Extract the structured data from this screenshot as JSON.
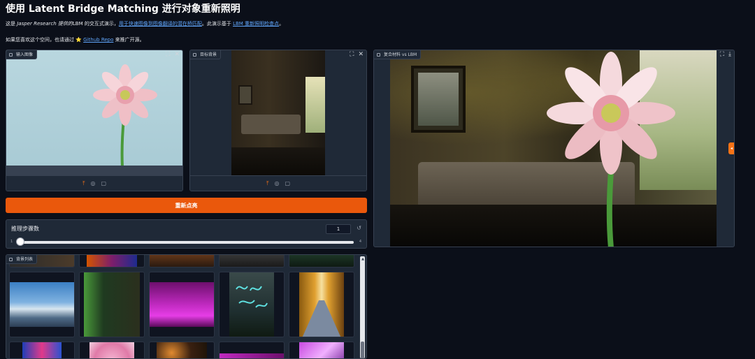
{
  "title": "使用 Latent Bridge Matching 进行对象重新照明",
  "intro": {
    "line1_prefix": "这是 ",
    "line1_org": "Jasper Research 提供的",
    "line1_mid": "LBM 的交互式演示，",
    "line1_link1": "用于快速图像到图像翻译的潜在桥匹配",
    "line1_mid2": "。此演示基于 ",
    "line1_link2": "LBM 重新照明检查点",
    "line1_suffix": "。",
    "line2_prefix": "如果您喜欢这个空间，也请通过 ⭐ ",
    "line2_link": "Github Repo",
    "line2_suffix": " 来推广开源。"
  },
  "input_panel": {
    "label": "输入图像",
    "actions": [
      "⛶",
      "✕"
    ],
    "tools": [
      "⤒",
      "◎",
      "▢"
    ]
  },
  "target_panel": {
    "label": "目标背景",
    "actions": [
      "⛶",
      "✕"
    ],
    "tools": [
      "⤒",
      "◎",
      "▢"
    ]
  },
  "result_panel": {
    "label": "复合材料 vs LBM",
    "actions": [
      "◌",
      "⛶",
      "⤓"
    ],
    "handle": "◂"
  },
  "relight_button": "重新点亮",
  "slider": {
    "label": "推理步骤数",
    "value": "1",
    "min": "1",
    "max": "4",
    "reset": "↺",
    "level": 0
  },
  "gallery": {
    "label": "背景列表",
    "scroll_up": "▲"
  },
  "colors": {
    "bg": "#0b0f19",
    "panel": "#1f2937",
    "accent": "#ea580c",
    "link": "#60a5fa"
  }
}
